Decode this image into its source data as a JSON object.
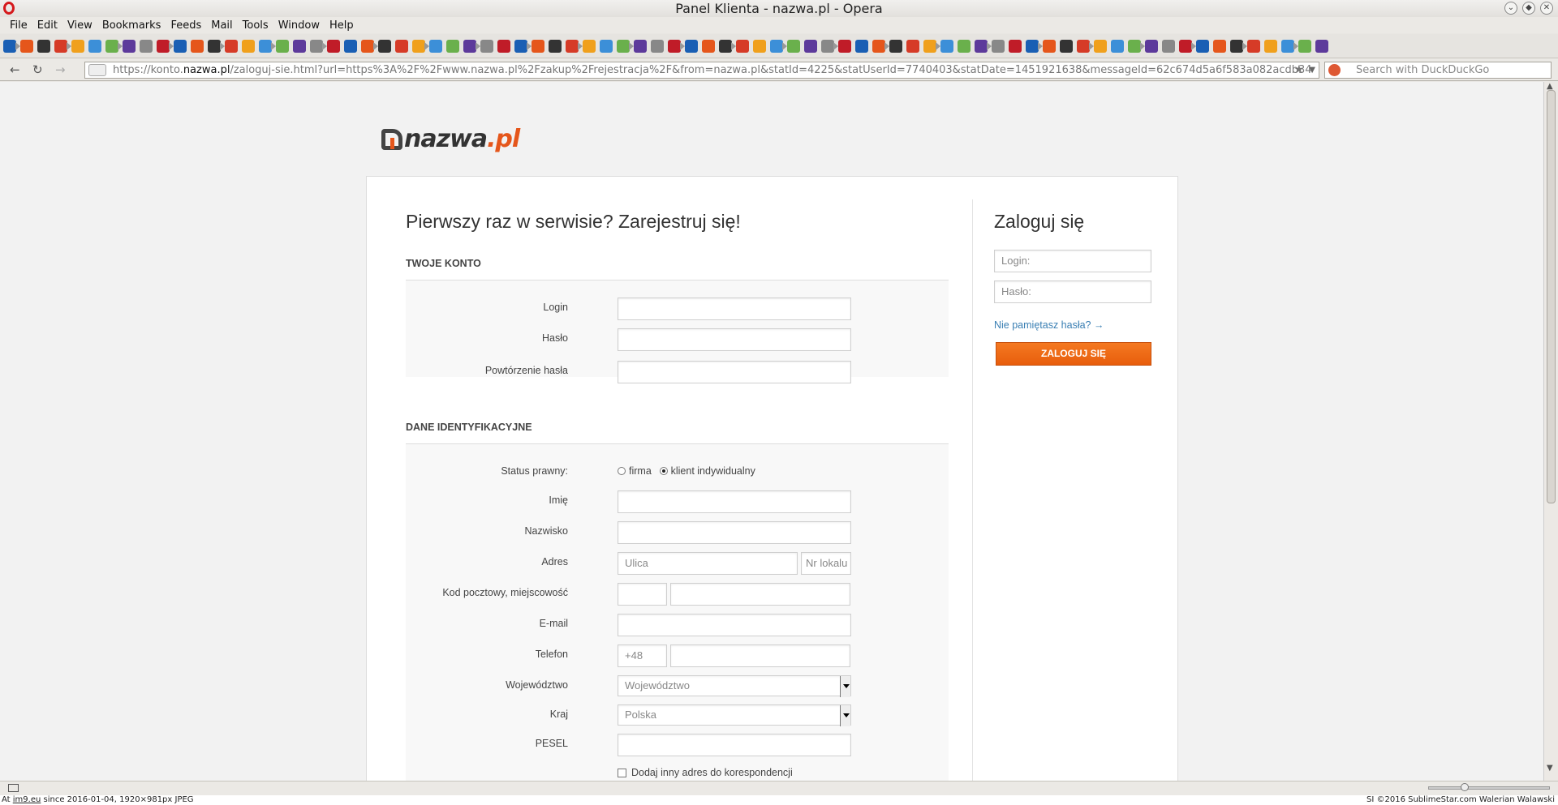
{
  "window": {
    "title": "Panel Klienta - nazwa.pl - Opera"
  },
  "menu": [
    "File",
    "Edit",
    "View",
    "Bookmarks",
    "Feeds",
    "Mail",
    "Tools",
    "Window",
    "Help"
  ],
  "bookmarks": {
    "count": 78,
    "colors": [
      "#1a5fb4",
      "#e5561b",
      "#333333",
      "#d63b27",
      "#f0a01c",
      "#3c8fd8",
      "#6ab04c",
      "#5d3a9b",
      "#888888",
      "#c01c28"
    ]
  },
  "address": {
    "url_prefix": "https://konto.",
    "url_host": "nazwa.pl",
    "url_rest": "/zaloguj-sie.html?url=https%3A%2F%2Fwww.nazwa.pl%2Fzakup%2Frejestracja%2F&from=nazwa.pl&statId=4225&statUserId=7740403&statDate=1451921638&messageId=62c674d5a6f583a082acdb34",
    "search_placeholder": "Search with DuckDuckGo"
  },
  "logo": {
    "name": "nazwa",
    "tld": ".pl"
  },
  "register": {
    "heading": "Pierwszy raz w serwisie? Zarejestruj się!",
    "section_account": "TWOJE KONTO",
    "login_label": "Login",
    "password_label": "Hasło",
    "password_repeat_label": "Powtórzenie hasła",
    "section_identity": "DANE IDENTYFIKACYJNE",
    "status_label": "Status prawny:",
    "status_company": "firma",
    "status_individual": "klient indywidualny",
    "status_selected": "klient indywidualny",
    "first_name_label": "Imię",
    "last_name_label": "Nazwisko",
    "address_label": "Adres",
    "street_placeholder": "Ulica",
    "unit_placeholder": "Nr lokalu",
    "postal_label": "Kod pocztowy, miejscowość",
    "email_label": "E-mail",
    "phone_label": "Telefon",
    "phone_prefix": "+48",
    "province_label": "Województwo",
    "province_value": "Województwo",
    "country_label": "Kraj",
    "country_value": "Polska",
    "pesel_label": "PESEL",
    "alt_address_checkbox": "Dodaj inny adres do korespondencji"
  },
  "login": {
    "heading": "Zaloguj się",
    "login_placeholder": "Login:",
    "password_placeholder": "Hasło:",
    "forgot_link": "Nie pamiętasz hasła? →",
    "submit": "ZALOGUJ SIĘ"
  },
  "footer": {
    "left_prefix": "At ",
    "left_site": "im9.eu",
    "left_rest": " since 2016-01-04, 1920×981px JPEG",
    "right": "SI ©2016 SublimeStar.com Walerian Walawski"
  }
}
